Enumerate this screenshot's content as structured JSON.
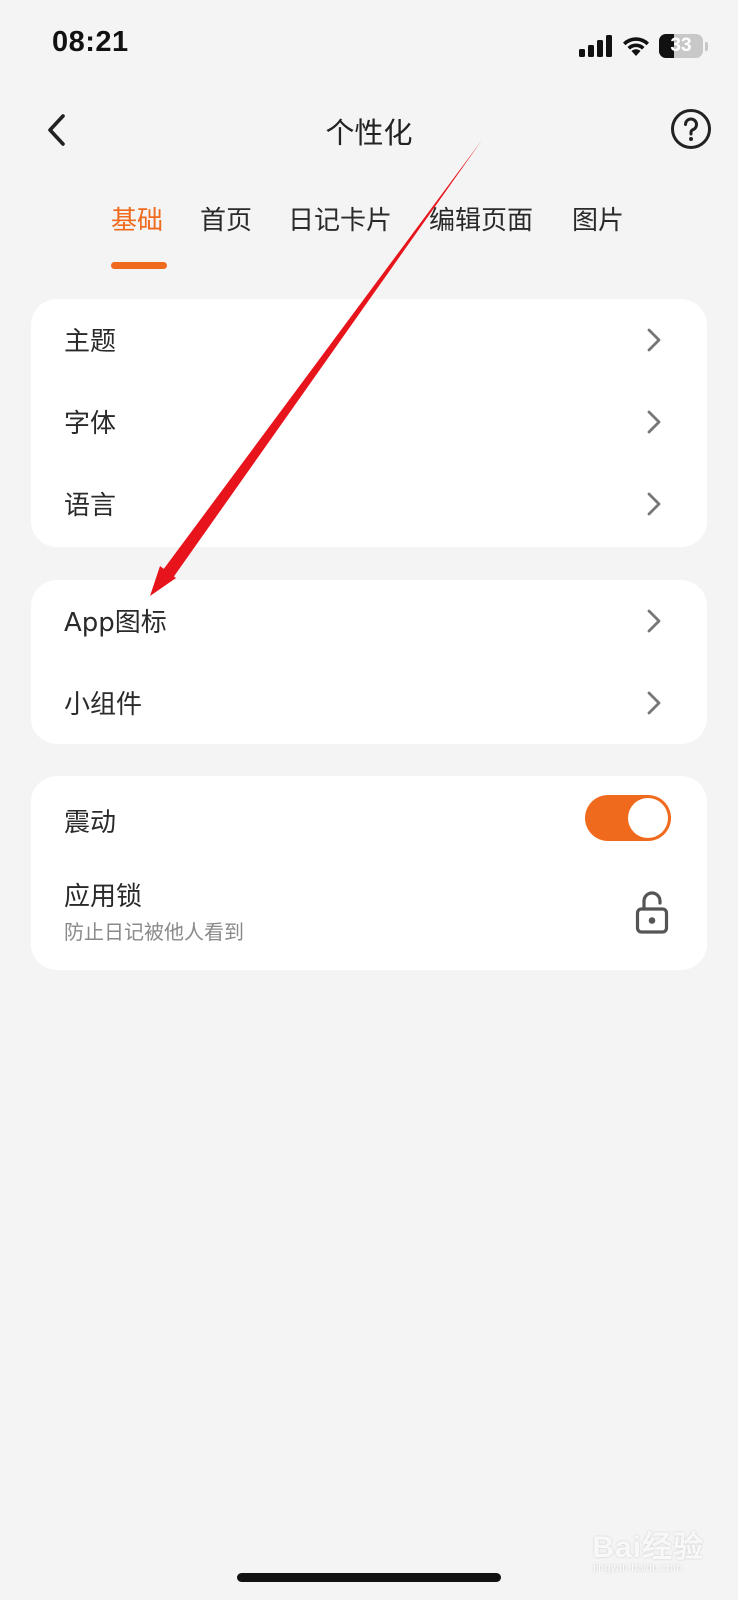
{
  "status_bar": {
    "time": "08:21",
    "battery_level": "33",
    "battery_fraction": 0.33,
    "icons": [
      "signal-icon",
      "wifi-icon",
      "battery-icon"
    ]
  },
  "nav": {
    "title": "个性化",
    "back_icon": "chevron-left-icon",
    "help_icon": "question-circle-icon"
  },
  "tabs": [
    {
      "label": "基础",
      "active": true
    },
    {
      "label": "首页",
      "active": false
    },
    {
      "label": "日记卡片",
      "active": false
    },
    {
      "label": "编辑页面",
      "active": false
    },
    {
      "label": "图片",
      "active": false
    }
  ],
  "groups": {
    "appearance": [
      {
        "label": "主题"
      },
      {
        "label": "字体"
      },
      {
        "label": "语言"
      }
    ],
    "icon_widget": [
      {
        "label": "App图标"
      },
      {
        "label": "小组件"
      }
    ],
    "system": {
      "vibration": {
        "label": "震动",
        "enabled": true
      },
      "app_lock": {
        "label": "应用锁",
        "subtitle": "防止日记被他人看到",
        "icon": "lock-icon"
      }
    }
  },
  "watermark": {
    "brand": "Bai经验",
    "sub": "jingyan.baidu.com"
  },
  "colors": {
    "accent": "#f06a1e",
    "background": "#f4f4f4",
    "card": "#ffffff",
    "annotation_arrow": "#e8141c"
  }
}
